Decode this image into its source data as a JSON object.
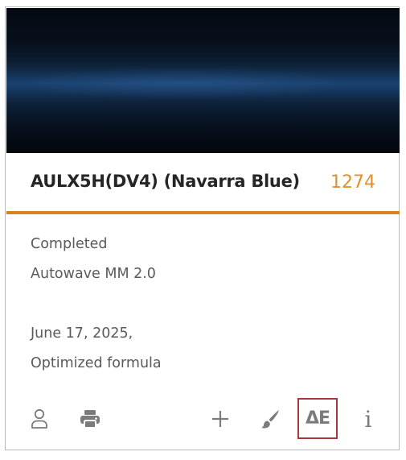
{
  "card": {
    "swatch_color": "#1a426e",
    "accent_color": "#d4861a",
    "code_color": "#e0902c",
    "title": "AULX5H(DV4) (Navarra Blue)",
    "code_number": "1274",
    "status": "Completed",
    "system": "Autowave MM 2.0",
    "date": "June 17, 2025,",
    "formula_type": "Optimized formula"
  },
  "toolbar": {
    "user_icon": "user-icon",
    "print_icon": "printer-icon",
    "add_icon": "plus-icon",
    "paint_icon": "paintbrush-icon",
    "delta_e_label": "ΔE",
    "delta_e_highlight_color": "#a8373a",
    "info_label": "i"
  }
}
